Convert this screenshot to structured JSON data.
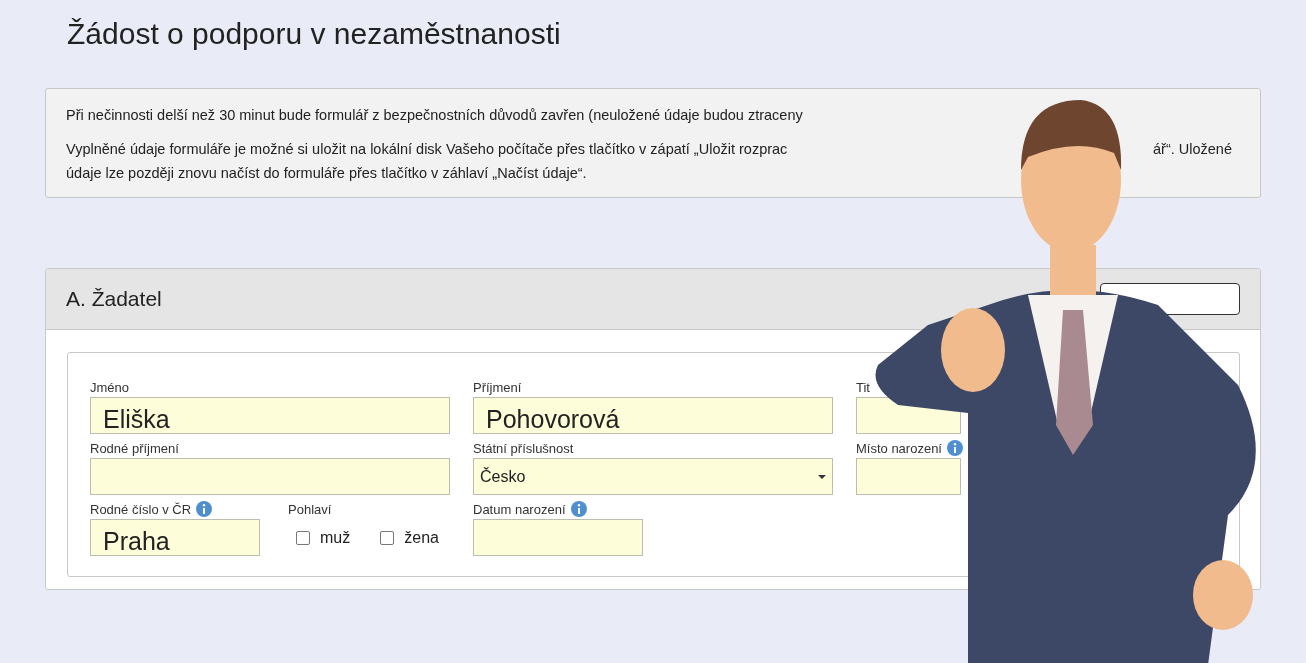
{
  "page_title": "Žádost o podporu v nezaměstnanosti",
  "notice": {
    "paragraphs": [
      {
        "lines": [
          [
            "Při nečinnosti delší než 30 minut bude formulář z bezpečnostních důvodů zavřen (neuložené údaje budou ztraceny"
          ]
        ]
      },
      {
        "lines": [
          [
            "Vyplněné údaje formuláře je možné si uložit na lokální disk Vašeho počítače přes tlačítko v zápatí „Uložit rozprac",
            "ář“. Uložené"
          ],
          [
            "údaje lze později znovu načíst do formuláře přes tlačítko v záhlaví „Načíst údaje“."
          ]
        ]
      }
    ]
  },
  "section": {
    "title": "A. Žadatel",
    "rows": [
      [
        {
          "kind": "text",
          "label": "Jméno",
          "value": "Eliška"
        },
        {
          "kind": "text",
          "label": "Příjmení",
          "value": "Pohovorová"
        },
        {
          "kind": "text",
          "label": "Tit"
        }
      ],
      [
        {
          "kind": "text",
          "label": "Rodné příjmení"
        },
        {
          "kind": "select",
          "label": "Státní příslušnost",
          "value": "Česko"
        },
        {
          "kind": "text",
          "label": "Místo narození",
          "info": true
        }
      ],
      [
        {
          "kind": "group",
          "fields": [
            {
              "kind": "text",
              "label": "Rodné číslo v ČR",
              "value": "Praha",
              "info": true
            },
            {
              "kind": "checks",
              "label": "Pohlaví",
              "options": [
                {
                  "label": "muž",
                  "checked": false
                },
                {
                  "label": "žena",
                  "checked": false
                }
              ]
            }
          ]
        },
        {
          "kind": "text",
          "label": "Datum narození",
          "info": true
        }
      ]
    ]
  }
}
